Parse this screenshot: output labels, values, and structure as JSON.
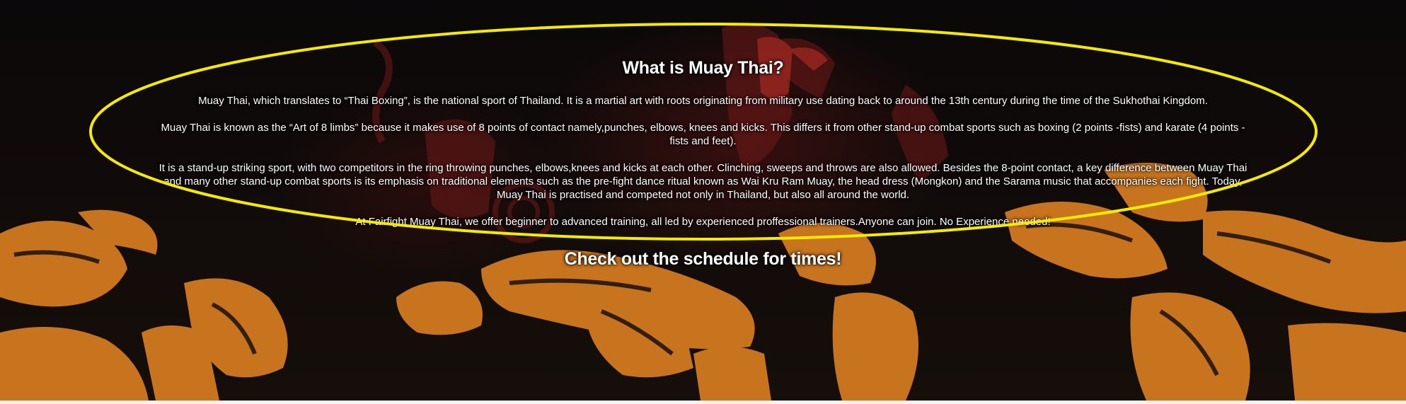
{
  "hero": {
    "title": "What is Muay Thai?",
    "paragraphs": [
      "Muay Thai, which translates to “Thai Boxing”, is the national sport of Thailand. It is a martial art with roots originating from military use dating back to around the 13th century during the time of the Sukhothai Kingdom.",
      "Muay Thai is known as the “Art of 8 limbs” because it makes use of 8 points of contact namely,punches, elbows, knees and kicks. This differs it from other stand-up combat sports such as boxing (2 points -fists) and karate (4 points - fists and feet).",
      "It is a stand-up striking sport, with two competitors in the ring throwing punches, elbows,knees and kicks at each other. Clinching, sweeps and throws are also allowed. Besides the 8-point contact, a key difference between Muay Thai and many other stand-up combat sports is its emphasis on traditional elements such as the pre-fight dance ritual known as Wai Kru Ram Muay, the head dress (Mongkon) and the Sarama music that accompanies each fight. Today, Muay Thai is practised and competed not only in Thailand, but also all around the world.",
      "At Fairfight Muay Thai, we offer beginner to advanced training, all led by experienced proffessional trainers.Anyone can join. No Experience needed!"
    ],
    "cta": "Check out the schedule for times!"
  },
  "colors": {
    "background": "#0a0808",
    "figure_orange": "#c8741f",
    "figure_red": "#7a1c1a",
    "text": "#ffffff",
    "annotation_yellow": "#f5eb00"
  },
  "decorations": {
    "background_art": "muay-thai-fighters-illustration",
    "annotation": "yellow-ellipse-highlight"
  }
}
